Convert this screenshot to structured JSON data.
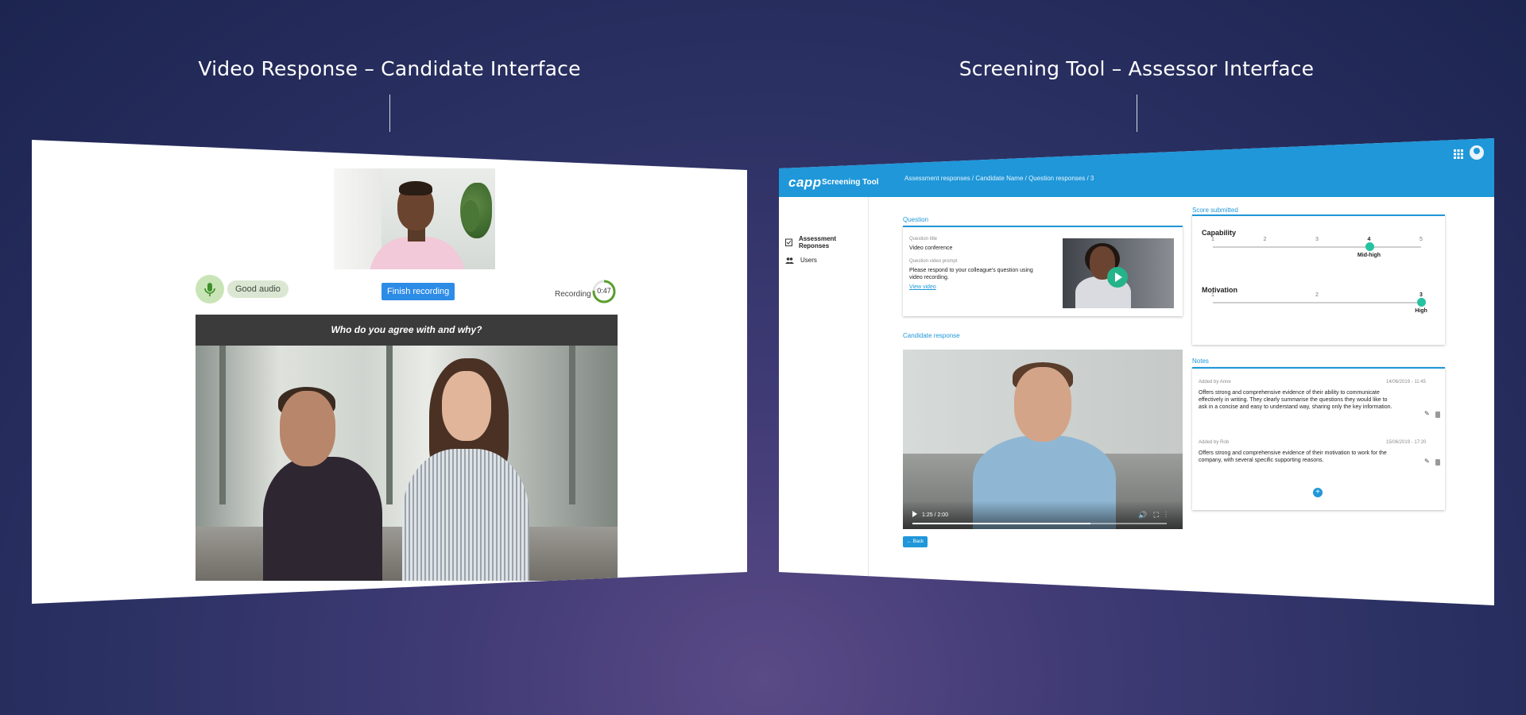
{
  "headings": {
    "left": "Video Response – Candidate Interface",
    "right": "Screening Tool – Assessor Interface"
  },
  "candidate": {
    "audio_status": "Good audio",
    "finish_button": "Finish recording",
    "recording_label": "Recording",
    "timer": "0:47",
    "question_prompt": "Who do you agree with and why?"
  },
  "assessor": {
    "logo": "capp",
    "app_title": "Screening Tool",
    "breadcrumb": "Assessment responses / Candidate Name / Question responses / 3",
    "sidebar": [
      {
        "label": "Assessment Reponses",
        "icon": "clipboard-check-icon"
      },
      {
        "label": "Users",
        "icon": "people-icon"
      }
    ],
    "collapse": "«",
    "question_section": "Question",
    "question_title_label": "Question title",
    "question_title_value": "Video conference",
    "question_prompt_label": "Question video prompt",
    "question_prompt_text": "Please respond to your colleague's question using video recording.",
    "view_video": "View video",
    "candidate_response_section": "Candidate response",
    "video_time": "1:25 / 2:00",
    "video_progress": 0.7,
    "back_button": "Back",
    "score_section": "Score submitted",
    "scores": [
      {
        "name": "Capability",
        "ticks": [
          "1",
          "2",
          "3",
          "4",
          "5"
        ],
        "value": 4,
        "value_label": "Mid-high"
      },
      {
        "name": "Motivation",
        "ticks": [
          "1",
          "2",
          "3"
        ],
        "value": 3,
        "value_label": "High"
      }
    ],
    "notes_section": "Notes",
    "notes": [
      {
        "by": "Added by Anne",
        "datetime": "14/06/2019 - 11:45",
        "text": "Offers strong and comprehensive evidence of their ability to communicate effectively in writing. They clearly summarise the questions they would like to ask in a concise and easy to understand way, sharing only the key information."
      },
      {
        "by": "Added by Rob",
        "datetime": "15/06/2019 - 17:20",
        "text": "Offers strong and comprehensive evidence of their motivation to work for the company, with several specific supporting reasons."
      }
    ],
    "accent_color": "#1f97d9",
    "score_color": "#25c2a0"
  }
}
